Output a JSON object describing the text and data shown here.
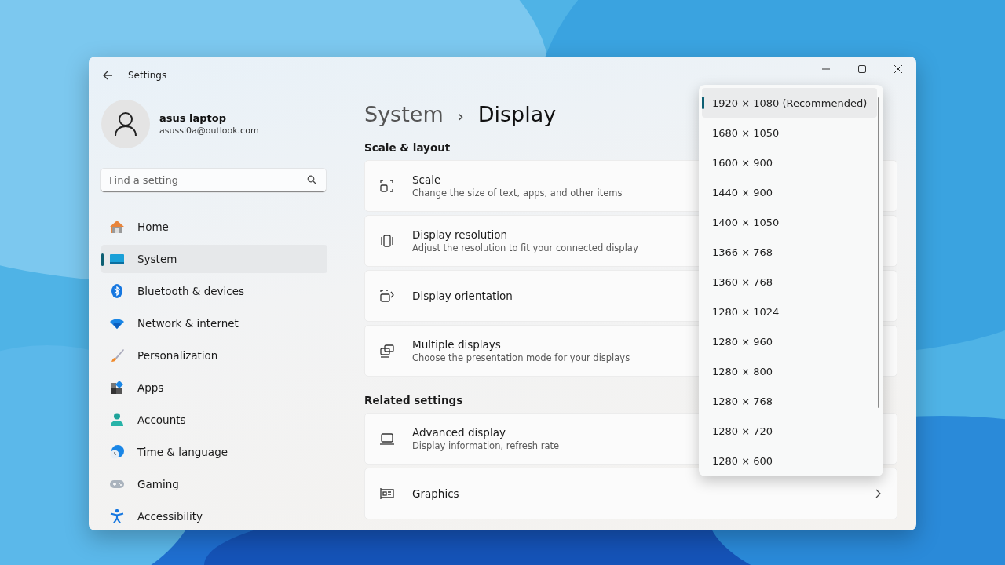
{
  "window": {
    "title": "Settings"
  },
  "account": {
    "name": "asus laptop",
    "email": "asussl0a@outlook.com"
  },
  "search": {
    "placeholder": "Find a setting"
  },
  "sidebar": {
    "items": [
      {
        "label": "Home",
        "selected": false
      },
      {
        "label": "System",
        "selected": true
      },
      {
        "label": "Bluetooth & devices",
        "selected": false
      },
      {
        "label": "Network & internet",
        "selected": false
      },
      {
        "label": "Personalization",
        "selected": false
      },
      {
        "label": "Apps",
        "selected": false
      },
      {
        "label": "Accounts",
        "selected": false
      },
      {
        "label": "Time & language",
        "selected": false
      },
      {
        "label": "Gaming",
        "selected": false
      },
      {
        "label": "Accessibility",
        "selected": false
      }
    ]
  },
  "breadcrumb": {
    "parent": "System",
    "separator": "›",
    "current": "Display"
  },
  "sections": [
    {
      "title": "Scale & layout",
      "cards": [
        {
          "title": "Scale",
          "subtitle": "Change the size of text, apps, and other items"
        },
        {
          "title": "Display resolution",
          "subtitle": "Adjust the resolution to fit your connected display"
        },
        {
          "title": "Display orientation"
        },
        {
          "title": "Multiple displays",
          "subtitle": "Choose the presentation mode for your displays"
        }
      ]
    },
    {
      "title": "Related settings",
      "cards": [
        {
          "title": "Advanced display",
          "subtitle": "Display information, refresh rate"
        },
        {
          "title": "Graphics",
          "chevron": true
        }
      ]
    }
  ],
  "resolution_dropdown": {
    "options": [
      {
        "label": "1920 × 1080 (Recommended)",
        "selected": true
      },
      {
        "label": "1680 × 1050",
        "selected": false
      },
      {
        "label": "1600 × 900",
        "selected": false
      },
      {
        "label": "1440 × 900",
        "selected": false
      },
      {
        "label": "1400 × 1050",
        "selected": false
      },
      {
        "label": "1366 × 768",
        "selected": false
      },
      {
        "label": "1360 × 768",
        "selected": false
      },
      {
        "label": "1280 × 1024",
        "selected": false
      },
      {
        "label": "1280 × 960",
        "selected": false
      },
      {
        "label": "1280 × 800",
        "selected": false
      },
      {
        "label": "1280 × 768",
        "selected": false
      },
      {
        "label": "1280 × 720",
        "selected": false
      },
      {
        "label": "1280 × 600",
        "selected": false
      }
    ]
  }
}
